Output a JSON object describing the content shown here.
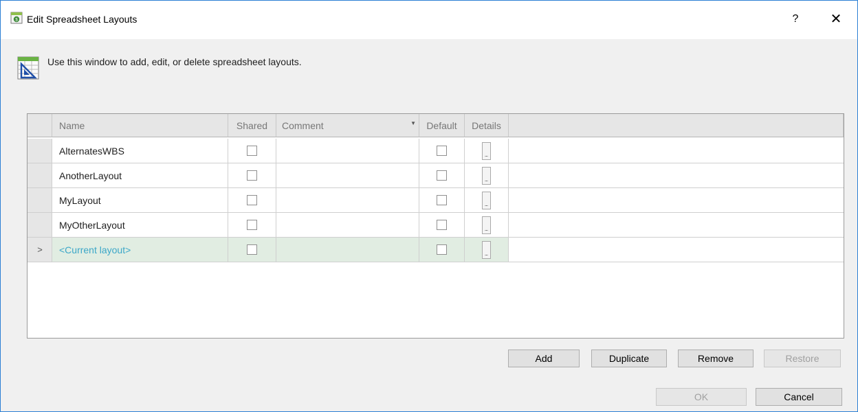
{
  "window": {
    "title": "Edit Spreadsheet Layouts",
    "help_label": "?",
    "close_label": "✕"
  },
  "header": {
    "instructions": "Use this window to add, edit, or delete spreadsheet layouts."
  },
  "grid": {
    "columns": {
      "name": "Name",
      "shared": "Shared",
      "comment": "Comment",
      "default": "Default",
      "details": "Details"
    },
    "details_button_label": "...",
    "current_row_indicator": ">",
    "rows": [
      {
        "name": "AlternatesWBS",
        "shared": false,
        "comment": "",
        "default": false
      },
      {
        "name": "AnotherLayout",
        "shared": false,
        "comment": "",
        "default": false
      },
      {
        "name": "MyLayout",
        "shared": false,
        "comment": "",
        "default": false
      },
      {
        "name": "MyOtherLayout",
        "shared": false,
        "comment": "",
        "default": false
      },
      {
        "name": "<Current layout>",
        "shared": false,
        "comment": "",
        "default": false,
        "current": true
      }
    ]
  },
  "buttons": {
    "add": "Add",
    "duplicate": "Duplicate",
    "remove": "Remove",
    "restore": "Restore",
    "ok": "OK",
    "cancel": "Cancel"
  },
  "colors": {
    "accent_border": "#2b7fd4",
    "current_row_bg": "#e1ede2",
    "current_row_text": "#3ba7c8",
    "disabled_text": "#a0a0a0"
  },
  "icons": {
    "app": "spreadsheet-layout-app-icon",
    "header": "spreadsheet-layout-icon",
    "sort": "sort-down-icon",
    "help": "help-icon",
    "close": "close-icon"
  }
}
